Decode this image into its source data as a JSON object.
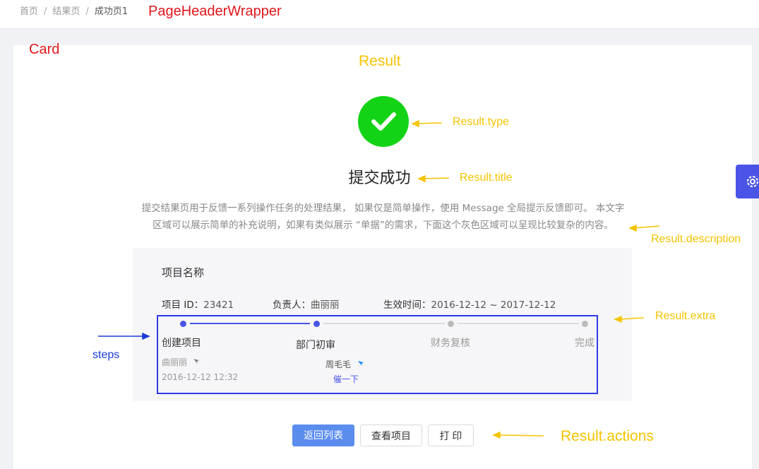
{
  "breadcrumb": {
    "items": [
      "首页",
      "结果页",
      "成功页1"
    ]
  },
  "annotations": {
    "page_header": "PageHeaderWrapper",
    "card": "Card",
    "result": "Result",
    "type": "Result.type",
    "title": "Result.title",
    "description": "Result.description",
    "extra": "Result.extra",
    "steps": "steps",
    "actions": "Result.actions"
  },
  "result": {
    "title": "提交成功",
    "description_line1": "提交结果页用于反馈一系列操作任务的处理结果， 如果仅是简单操作，使用 Message 全局提示反馈即可。 本文字",
    "description_line2": "区域可以展示简单的补充说明，如果有类似展示 “单据”的需求，下面这个灰色区域可以呈现比较复杂的内容。"
  },
  "project": {
    "name": "项目名称",
    "id_label": "项目 ID：",
    "id_value": "23421",
    "owner_label": "负责人：",
    "owner_value": "曲丽丽",
    "time_label": "生效时间：",
    "time_value": "2016-12-12 ~ 2017-12-12"
  },
  "steps": [
    {
      "title": "创建项目",
      "person": "曲丽丽",
      "time": "2016-12-12 12:32"
    },
    {
      "title": "部门初审",
      "person": "周毛毛",
      "action": "催一下"
    },
    {
      "title": "财务复核"
    },
    {
      "title": "完成"
    }
  ],
  "actions": {
    "back": "返回列表",
    "view": "查看项目",
    "print": "打 印"
  },
  "colors": {
    "success": "#13d317",
    "primary": "#4a55e8",
    "annotation_yellow": "#f5c400",
    "annotation_red": "#e0171b",
    "annotation_blue": "#1a3bd6"
  }
}
